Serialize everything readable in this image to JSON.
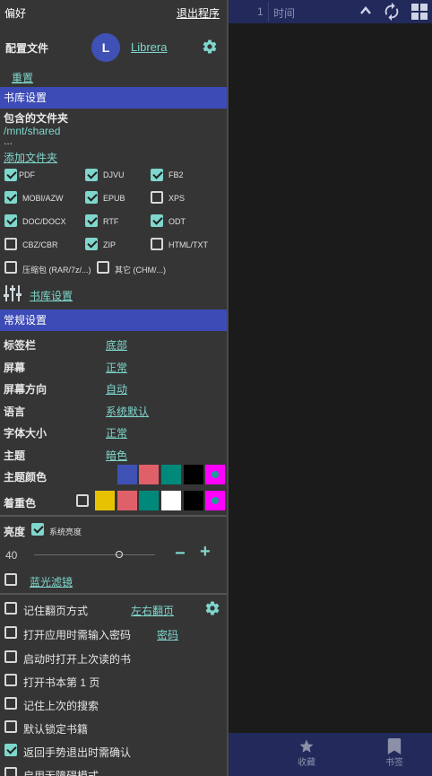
{
  "header": {
    "title": "偏好",
    "exit": "退出程序"
  },
  "profile": {
    "label": "配置文件",
    "avatar_letter": "L",
    "name": "Librera",
    "reset": "重置"
  },
  "library": {
    "section_title": "书库设置",
    "folders_label": "包含的文件夹",
    "folder_path": "/mnt/shared",
    "ellipsis": "...",
    "add_folder": "添加文件夹",
    "formats": [
      {
        "label": "PDF",
        "checked": true
      },
      {
        "label": "DJVU",
        "checked": true
      },
      {
        "label": "FB2",
        "checked": true
      },
      {
        "label": "MOBI/AZW",
        "checked": true
      },
      {
        "label": "EPUB",
        "checked": true
      },
      {
        "label": "XPS",
        "checked": false
      },
      {
        "label": "DOC/DOCX",
        "checked": true
      },
      {
        "label": "RTF",
        "checked": true
      },
      {
        "label": "ODT",
        "checked": true
      },
      {
        "label": "CBZ/CBR",
        "checked": false
      },
      {
        "label": "ZIP",
        "checked": true
      },
      {
        "label": "HTML/TXT",
        "checked": false
      }
    ],
    "archives": "压缩包 (RAR/7z/...)",
    "others": "其它 (CHM/...)",
    "library_settings_link": "书库设置"
  },
  "general": {
    "section_title": "常规设置",
    "rows": [
      {
        "label": "标签栏",
        "value": "底部"
      },
      {
        "label": "屏幕",
        "value": "正常"
      },
      {
        "label": "屏幕方向",
        "value": "自动"
      },
      {
        "label": "语言",
        "value": "系统默认"
      },
      {
        "label": "字体大小",
        "value": "正常"
      },
      {
        "label": "主题",
        "value": "暗色"
      }
    ],
    "theme_color_label": "主题颜色",
    "theme_colors": [
      "#3f51b5",
      "#e0606a",
      "#00897b",
      "#000000",
      "#ff00ff"
    ],
    "accent_label": "着重色",
    "accent_colors": [
      "#e6c200",
      "#e0606a",
      "#00897b",
      "#ffffff",
      "#000000",
      "#ff00ff"
    ]
  },
  "brightness": {
    "label": "亮度",
    "system_label": "系统亮度",
    "value": "40",
    "minus": "−",
    "plus": "+",
    "blue_filter": "蓝光滤镜"
  },
  "options": {
    "remember_paging": "记住翻页方式",
    "paging_mode": "左右翻页",
    "password_on_open": "打开应用时需输入密码",
    "password_link": "密码",
    "open_last_book": "启动时打开上次读的书",
    "open_first_page": "打开书本第 1 页",
    "remember_search": "记住上次的搜索",
    "lock_book": "默认锁定书籍",
    "confirm_exit": "返回手势退出时需确认",
    "accessibility": "启用无障碍模式"
  },
  "right_panel": {
    "page_number": "1",
    "time_label": "时间",
    "favorites": "收藏",
    "bookmarks": "书签"
  },
  "colors": {
    "accent": "#7fd6cc",
    "header_blue": "#3d4bb6",
    "panel_bg": "#353535"
  }
}
